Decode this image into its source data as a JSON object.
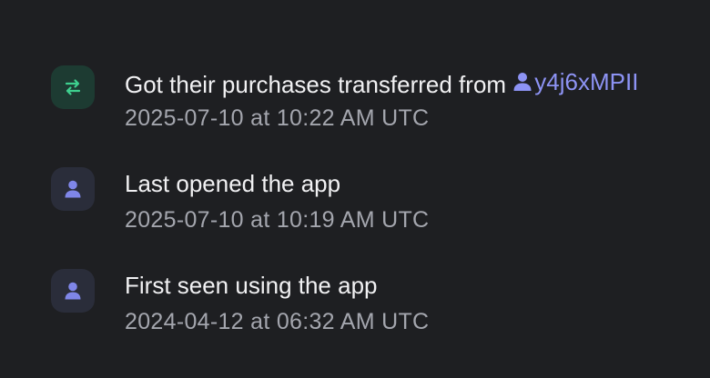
{
  "events": [
    {
      "title": "Got their purchases transferred from ",
      "linked_user": "y4j6xMPII",
      "timestamp": "2025-07-10 at 10:22 AM UTC",
      "icon": "transfer-icon"
    },
    {
      "title": "Last opened the app",
      "timestamp": "2025-07-10 at 10:19 AM UTC",
      "icon": "user-icon"
    },
    {
      "title": "First seen using the app",
      "timestamp": "2024-04-12 at 06:32 AM UTC",
      "icon": "user-icon"
    }
  ],
  "colors": {
    "background": "#1e1f22",
    "transfer_accent": "#3ecf8e",
    "user_accent": "#7f86e8",
    "link": "#8d93f4"
  }
}
